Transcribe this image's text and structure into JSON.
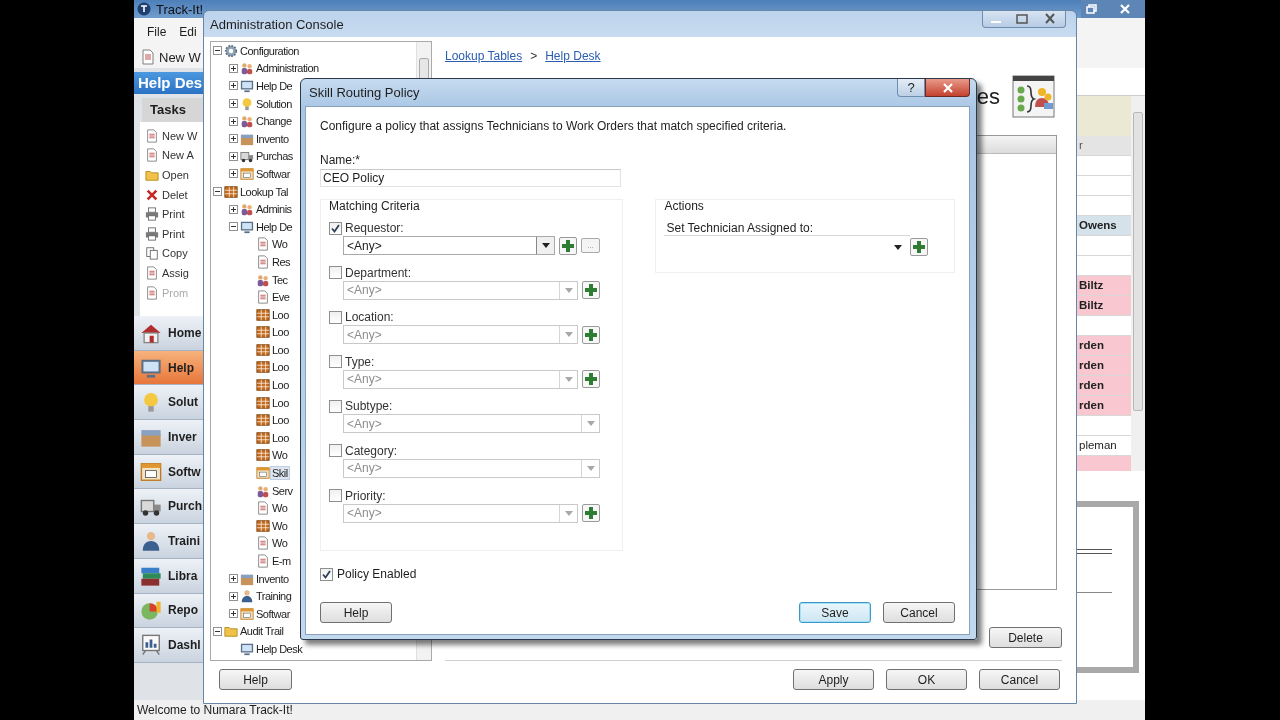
{
  "app": {
    "title": "Track-It!",
    "menu": [
      "File",
      "Edi"
    ],
    "toolbar": [
      "New W"
    ],
    "panel_title": "Help Des",
    "tasks_title": "Tasks",
    "tasks": [
      {
        "label": "New W",
        "disabled": false
      },
      {
        "label": "New A",
        "disabled": false
      },
      {
        "label": "Open",
        "disabled": false
      },
      {
        "label": "Delet",
        "disabled": false
      },
      {
        "label": "Print",
        "disabled": false
      },
      {
        "label": "Print",
        "disabled": false
      },
      {
        "label": "Copy",
        "disabled": false
      },
      {
        "label": "Assig",
        "disabled": false
      },
      {
        "label": "Prom",
        "disabled": true
      }
    ],
    "nav": [
      {
        "label": "Home",
        "selected": false
      },
      {
        "label": "Help",
        "selected": true
      },
      {
        "label": "Solut",
        "selected": false
      },
      {
        "label": "Inver",
        "selected": false
      },
      {
        "label": "Softw",
        "selected": false
      },
      {
        "label": "Purch",
        "selected": false
      },
      {
        "label": "Traini",
        "selected": false
      },
      {
        "label": "Libra",
        "selected": false
      },
      {
        "label": "Repo",
        "selected": false
      },
      {
        "label": "Dashl",
        "selected": false
      }
    ],
    "grid_rows": [
      {
        "kind": "header",
        "text": "r",
        "color": "#e4e4e4"
      },
      {
        "kind": "blank",
        "color": "#ffffff"
      },
      {
        "kind": "blank",
        "color": "#ffffff"
      },
      {
        "kind": "blank",
        "color": "#ffffff"
      },
      {
        "kind": "bold",
        "text": "Owens",
        "color": "#d5e2ea"
      },
      {
        "kind": "blank",
        "color": "#ffffff"
      },
      {
        "kind": "blank",
        "color": "#ffffff"
      },
      {
        "kind": "bold",
        "text": "Biltz",
        "color": "#f8c7d0"
      },
      {
        "kind": "bold",
        "text": "Biltz",
        "color": "#f8c7d0"
      },
      {
        "kind": "blank",
        "color": "#ffffff"
      },
      {
        "kind": "bold",
        "text": "rden",
        "color": "#f8c7d0"
      },
      {
        "kind": "bold",
        "text": "rden",
        "color": "#f8c7d0"
      },
      {
        "kind": "bold",
        "text": "rden",
        "color": "#f8c7d0"
      },
      {
        "kind": "bold",
        "text": "rden",
        "color": "#f8c7d0"
      },
      {
        "kind": "blank",
        "color": "#ffffff"
      },
      {
        "kind": "plain",
        "text": "pleman",
        "color": "#ffffff"
      },
      {
        "kind": "blank",
        "color": "#f8c7d0"
      }
    ],
    "status": "Welcome to Numara Track-It!"
  },
  "admin": {
    "title": "Administration Console",
    "tree": [
      {
        "label": "Configuration",
        "selected": false,
        "expanded": true,
        "children": [
          {
            "label": "Administration",
            "selected": false,
            "expanded": false
          },
          {
            "label": "Help De",
            "selected": false,
            "expanded": false
          },
          {
            "label": "Solution",
            "selected": false,
            "expanded": false
          },
          {
            "label": "Change",
            "selected": false,
            "expanded": false
          },
          {
            "label": "Invento",
            "selected": false,
            "expanded": false
          },
          {
            "label": "Purchas",
            "selected": false,
            "expanded": false
          },
          {
            "label": "Softwar",
            "selected": false,
            "expanded": false
          }
        ]
      },
      {
        "label": "Lookup Tal",
        "selected": false,
        "expanded": true,
        "children": [
          {
            "label": "Adminis",
            "selected": false,
            "expanded": false
          },
          {
            "label": "Help De",
            "selected": false,
            "expanded": true,
            "children": [
              {
                "label": "Wo",
                "selected": false
              },
              {
                "label": "Res",
                "selected": false
              },
              {
                "label": "Tec",
                "selected": false
              },
              {
                "label": "Eve",
                "selected": false
              },
              {
                "label": "Loo",
                "selected": false
              },
              {
                "label": "Loo",
                "selected": false
              },
              {
                "label": "Loo",
                "selected": false
              },
              {
                "label": "Loo",
                "selected": false
              },
              {
                "label": "Loo",
                "selected": false
              },
              {
                "label": "Loo",
                "selected": false
              },
              {
                "label": "Loo",
                "selected": false
              },
              {
                "label": "Loo",
                "selected": false
              },
              {
                "label": "Wo",
                "selected": false
              },
              {
                "label": "Skil",
                "selected": true
              },
              {
                "label": "Serv",
                "selected": false
              },
              {
                "label": "Wo",
                "selected": false
              },
              {
                "label": "Wo",
                "selected": false
              },
              {
                "label": "Wo",
                "selected": false
              },
              {
                "label": "E-m",
                "selected": false
              }
            ]
          },
          {
            "label": "Invento",
            "selected": false,
            "expanded": false
          },
          {
            "label": "Training",
            "selected": false,
            "expanded": false
          },
          {
            "label": "Softwar",
            "selected": false,
            "expanded": false
          }
        ]
      },
      {
        "label": "Audit Trail",
        "selected": false,
        "expanded": true,
        "children": [
          {
            "label": "Help Desk",
            "selected": false
          }
        ]
      }
    ],
    "breadcrumb": [
      {
        "label": "Lookup Tables"
      },
      {
        "label": "Help Desk"
      }
    ],
    "breadcrumb_separator": ">",
    "heading": "es",
    "buttons": {
      "delete": "Delete",
      "help": "Help",
      "apply": "Apply",
      "ok": "OK",
      "cancel": "Cancel"
    }
  },
  "dialog": {
    "title": "Skill Routing Policy",
    "help_glyph": "?",
    "description": "Configure a policy that assigns Technicians to Work Orders that match specified criteria.",
    "name_label": "Name:*",
    "name_value": "CEO Policy",
    "criteria_title": "Matching Criteria",
    "criteria": [
      {
        "label": "Requestor:",
        "checked": true,
        "value": "<Any>",
        "disabled": false,
        "add_button": true,
        "browse_button": "..."
      },
      {
        "label": "Department:",
        "checked": false,
        "value": "<Any>",
        "disabled": true,
        "add_button": true
      },
      {
        "label": "Location:",
        "checked": false,
        "value": "<Any>",
        "disabled": true,
        "add_button": true
      },
      {
        "label": "Type:",
        "checked": false,
        "value": "<Any>",
        "disabled": true,
        "add_button": true
      },
      {
        "label": "Subtype:",
        "checked": false,
        "value": "<Any>",
        "disabled": true,
        "add_button": false
      },
      {
        "label": "Category:",
        "checked": false,
        "value": "<Any>",
        "disabled": true,
        "add_button": false
      },
      {
        "label": "Priority:",
        "checked": false,
        "value": "<Any>",
        "disabled": true,
        "add_button": true
      }
    ],
    "actions_title": "Actions",
    "action_label": "Set Technician Assigned to:",
    "policy_enabled": {
      "label": "Policy Enabled",
      "checked": true
    },
    "buttons": {
      "help": "Help",
      "save": "Save",
      "cancel": "Cancel"
    }
  }
}
